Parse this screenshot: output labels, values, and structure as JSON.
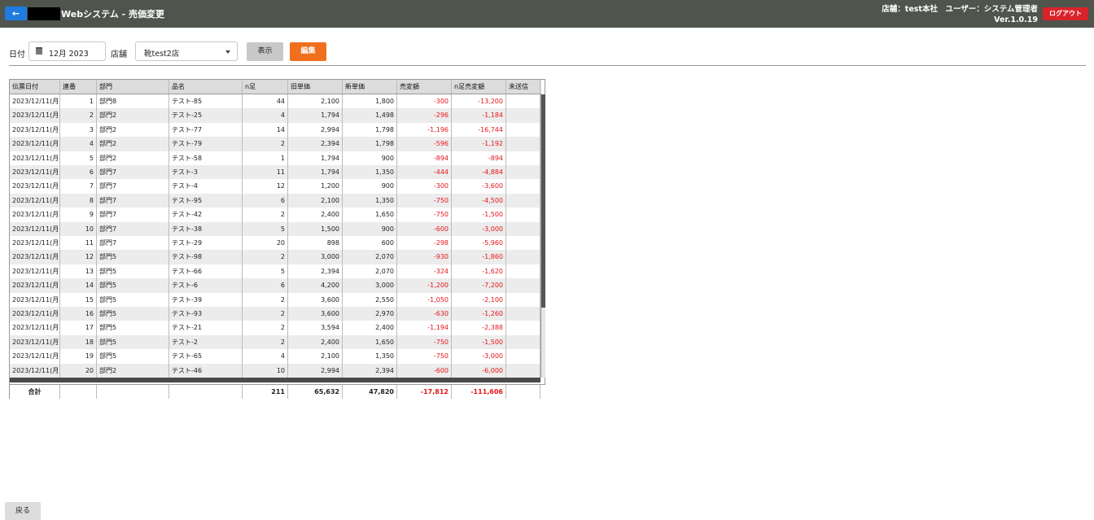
{
  "header": {
    "back_label": "←",
    "title": "Webシステム  -  売価変更",
    "store_info": "店舗：test本社　ユーザー：システム管理者",
    "version": "Ver.1.0.19",
    "logout_label": "ログアウト",
    "accent_color": "#1e7be0",
    "bar_color": "#4f544d",
    "logout_color": "#d9232a"
  },
  "filters": {
    "date_label": "日付",
    "date_value": "12月 2023",
    "store_label": "店舗",
    "store_value": "靴test2店",
    "show_label": "表示",
    "edit_label": "編集",
    "edit_color": "#f06f1d"
  },
  "grid": {
    "columns": [
      "伝票日付",
      "連番",
      "部門",
      "品名",
      "n足",
      "旧単価",
      "新単価",
      "売変額",
      "n足売変額",
      "未送信"
    ],
    "rows": [
      [
        "2023/12/11(月)",
        "1",
        "部門8",
        "テスト-85",
        "44",
        "2,100",
        "1,800",
        "-300",
        "-13,200",
        ""
      ],
      [
        "2023/12/11(月)",
        "2",
        "部門2",
        "テスト-25",
        "4",
        "1,794",
        "1,498",
        "-296",
        "-1,184",
        ""
      ],
      [
        "2023/12/11(月)",
        "3",
        "部門2",
        "テスト-77",
        "14",
        "2,994",
        "1,798",
        "-1,196",
        "-16,744",
        ""
      ],
      [
        "2023/12/11(月)",
        "4",
        "部門2",
        "テスト-79",
        "2",
        "2,394",
        "1,798",
        "-596",
        "-1,192",
        ""
      ],
      [
        "2023/12/11(月)",
        "5",
        "部門2",
        "テスト-58",
        "1",
        "1,794",
        "900",
        "-894",
        "-894",
        ""
      ],
      [
        "2023/12/11(月)",
        "6",
        "部門7",
        "テスト-3",
        "11",
        "1,794",
        "1,350",
        "-444",
        "-4,884",
        ""
      ],
      [
        "2023/12/11(月)",
        "7",
        "部門7",
        "テスト-4",
        "12",
        "1,200",
        "900",
        "-300",
        "-3,600",
        ""
      ],
      [
        "2023/12/11(月)",
        "8",
        "部門7",
        "テスト-95",
        "6",
        "2,100",
        "1,350",
        "-750",
        "-4,500",
        ""
      ],
      [
        "2023/12/11(月)",
        "9",
        "部門7",
        "テスト-42",
        "2",
        "2,400",
        "1,650",
        "-750",
        "-1,500",
        ""
      ],
      [
        "2023/12/11(月)",
        "10",
        "部門7",
        "テスト-38",
        "5",
        "1,500",
        "900",
        "-600",
        "-3,000",
        ""
      ],
      [
        "2023/12/11(月)",
        "11",
        "部門7",
        "テスト-29",
        "20",
        "898",
        "600",
        "-298",
        "-5,960",
        ""
      ],
      [
        "2023/12/11(月)",
        "12",
        "部門5",
        "テスト-98",
        "2",
        "3,000",
        "2,070",
        "-930",
        "-1,860",
        ""
      ],
      [
        "2023/12/11(月)",
        "13",
        "部門5",
        "テスト-66",
        "5",
        "2,394",
        "2,070",
        "-324",
        "-1,620",
        ""
      ],
      [
        "2023/12/11(月)",
        "14",
        "部門5",
        "テスト-6",
        "6",
        "4,200",
        "3,000",
        "-1,200",
        "-7,200",
        ""
      ],
      [
        "2023/12/11(月)",
        "15",
        "部門5",
        "テスト-39",
        "2",
        "3,600",
        "2,550",
        "-1,050",
        "-2,100",
        ""
      ],
      [
        "2023/12/11(月)",
        "16",
        "部門5",
        "テスト-93",
        "2",
        "3,600",
        "2,970",
        "-630",
        "-1,260",
        ""
      ],
      [
        "2023/12/11(月)",
        "17",
        "部門5",
        "テスト-21",
        "2",
        "3,594",
        "2,400",
        "-1,194",
        "-2,388",
        ""
      ],
      [
        "2023/12/11(月)",
        "18",
        "部門5",
        "テスト-2",
        "2",
        "2,400",
        "1,650",
        "-750",
        "-1,500",
        ""
      ],
      [
        "2023/12/11(月)",
        "19",
        "部門5",
        "テスト-65",
        "4",
        "2,100",
        "1,350",
        "-750",
        "-3,000",
        ""
      ],
      [
        "2023/12/11(月)",
        "20",
        "部門2",
        "テスト-46",
        "10",
        "2,994",
        "2,394",
        "-600",
        "-6,000",
        ""
      ]
    ],
    "totals": [
      "合計",
      "",
      "",
      "",
      "211",
      "65,632",
      "47,820",
      "-17,812",
      "-111,606",
      ""
    ],
    "negative_color": "#e8141a"
  },
  "footer": {
    "return_label": "戻る"
  }
}
